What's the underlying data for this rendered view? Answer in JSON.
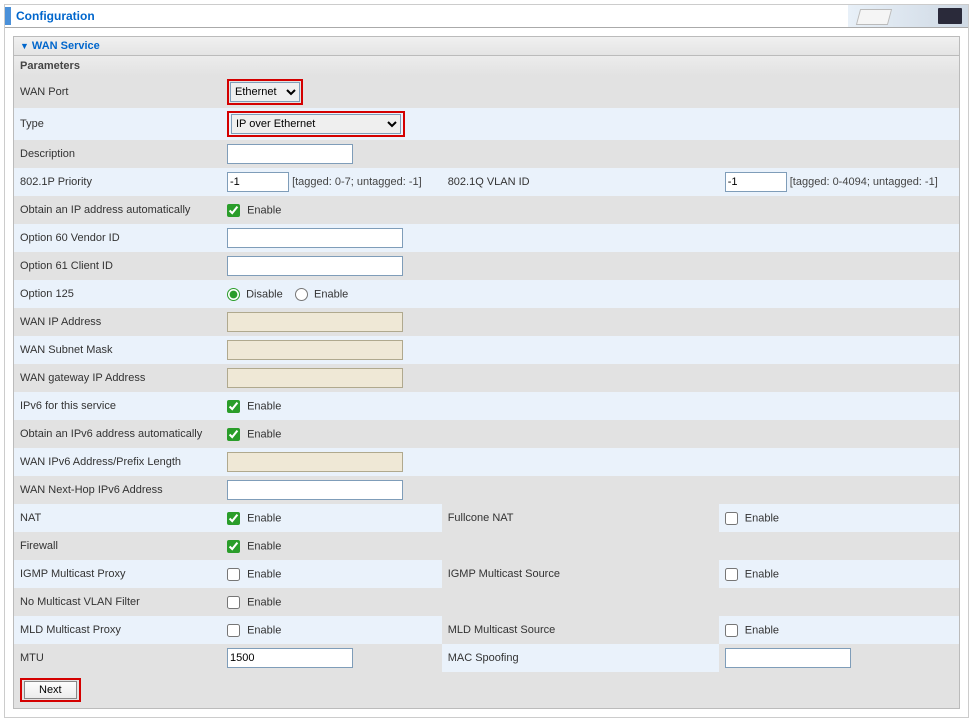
{
  "header": {
    "title": "Configuration"
  },
  "panel": {
    "title": "WAN Service",
    "paramsLabel": "Parameters"
  },
  "fields": {
    "wanPort": {
      "label": "WAN Port",
      "value": "Ethernet"
    },
    "type": {
      "label": "Type",
      "value": "IP over Ethernet"
    },
    "description": {
      "label": "Description",
      "value": ""
    },
    "priority": {
      "label": "802.1P Priority",
      "value": "-1",
      "hint": "[tagged: 0-7; untagged: -1]"
    },
    "vlan": {
      "label": "802.1Q VLAN ID",
      "value": "-1",
      "hint": "[tagged: 0-4094; untagged: -1]"
    },
    "obtainIP": {
      "label": "Obtain an IP address automatically",
      "opt": "Enable",
      "checked": true
    },
    "opt60": {
      "label": "Option 60 Vendor ID",
      "value": ""
    },
    "opt61": {
      "label": "Option 61 Client ID",
      "value": ""
    },
    "opt125": {
      "label": "Option 125",
      "disable": "Disable",
      "enable": "Enable"
    },
    "wanIP": {
      "label": "WAN IP Address",
      "value": ""
    },
    "wanMask": {
      "label": "WAN Subnet Mask",
      "value": ""
    },
    "wanGw": {
      "label": "WAN gateway IP Address",
      "value": ""
    },
    "ipv6svc": {
      "label": "IPv6 for this service",
      "opt": "Enable",
      "checked": true
    },
    "obtainIPv6": {
      "label": "Obtain an IPv6 address automatically",
      "opt": "Enable",
      "checked": true
    },
    "wanIPv6": {
      "label": "WAN IPv6 Address/Prefix Length",
      "value": ""
    },
    "wanNextHop": {
      "label": "WAN Next-Hop IPv6 Address",
      "value": ""
    },
    "nat": {
      "label": "NAT",
      "opt": "Enable",
      "checked": true
    },
    "fullcone": {
      "label": "Fullcone NAT",
      "opt": "Enable",
      "checked": false
    },
    "firewall": {
      "label": "Firewall",
      "opt": "Enable",
      "checked": true
    },
    "igmpProxy": {
      "label": "IGMP Multicast Proxy",
      "opt": "Enable",
      "checked": false
    },
    "igmpSource": {
      "label": "IGMP Multicast Source",
      "opt": "Enable",
      "checked": false
    },
    "noMcastVlan": {
      "label": "No Multicast VLAN Filter",
      "opt": "Enable",
      "checked": false
    },
    "mldProxy": {
      "label": "MLD Multicast Proxy",
      "opt": "Enable",
      "checked": false
    },
    "mldSource": {
      "label": "MLD Multicast Source",
      "opt": "Enable",
      "checked": false
    },
    "mtu": {
      "label": "MTU",
      "value": "1500"
    },
    "macSpoof": {
      "label": "MAC Spoofing",
      "value": ""
    }
  },
  "footer": {
    "next": "Next"
  }
}
